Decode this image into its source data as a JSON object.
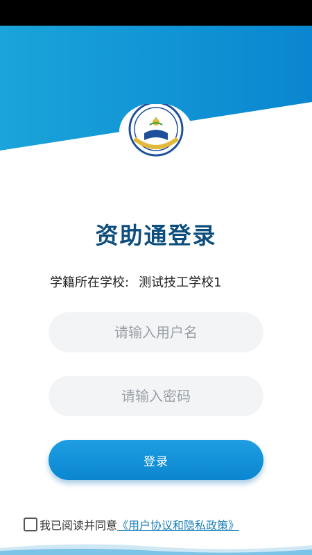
{
  "app": {
    "title": "资助通登录"
  },
  "school": {
    "label": "学籍所在学校:",
    "value": "测试技工学校1"
  },
  "form": {
    "username_placeholder": "请输入用户名",
    "password_placeholder": "请输入密码",
    "login_label": "登录"
  },
  "agreement": {
    "prefix": "我已阅读并同意",
    "link": "《用户协议和隐私政策》"
  },
  "logo": {
    "icon": "school-emblem-icon"
  },
  "colors": {
    "header_top": "#1aa4da",
    "header_bottom": "#0a86d0",
    "title": "#0d4e7d",
    "button": "#1f9ee3",
    "link": "#1a7fb8"
  }
}
